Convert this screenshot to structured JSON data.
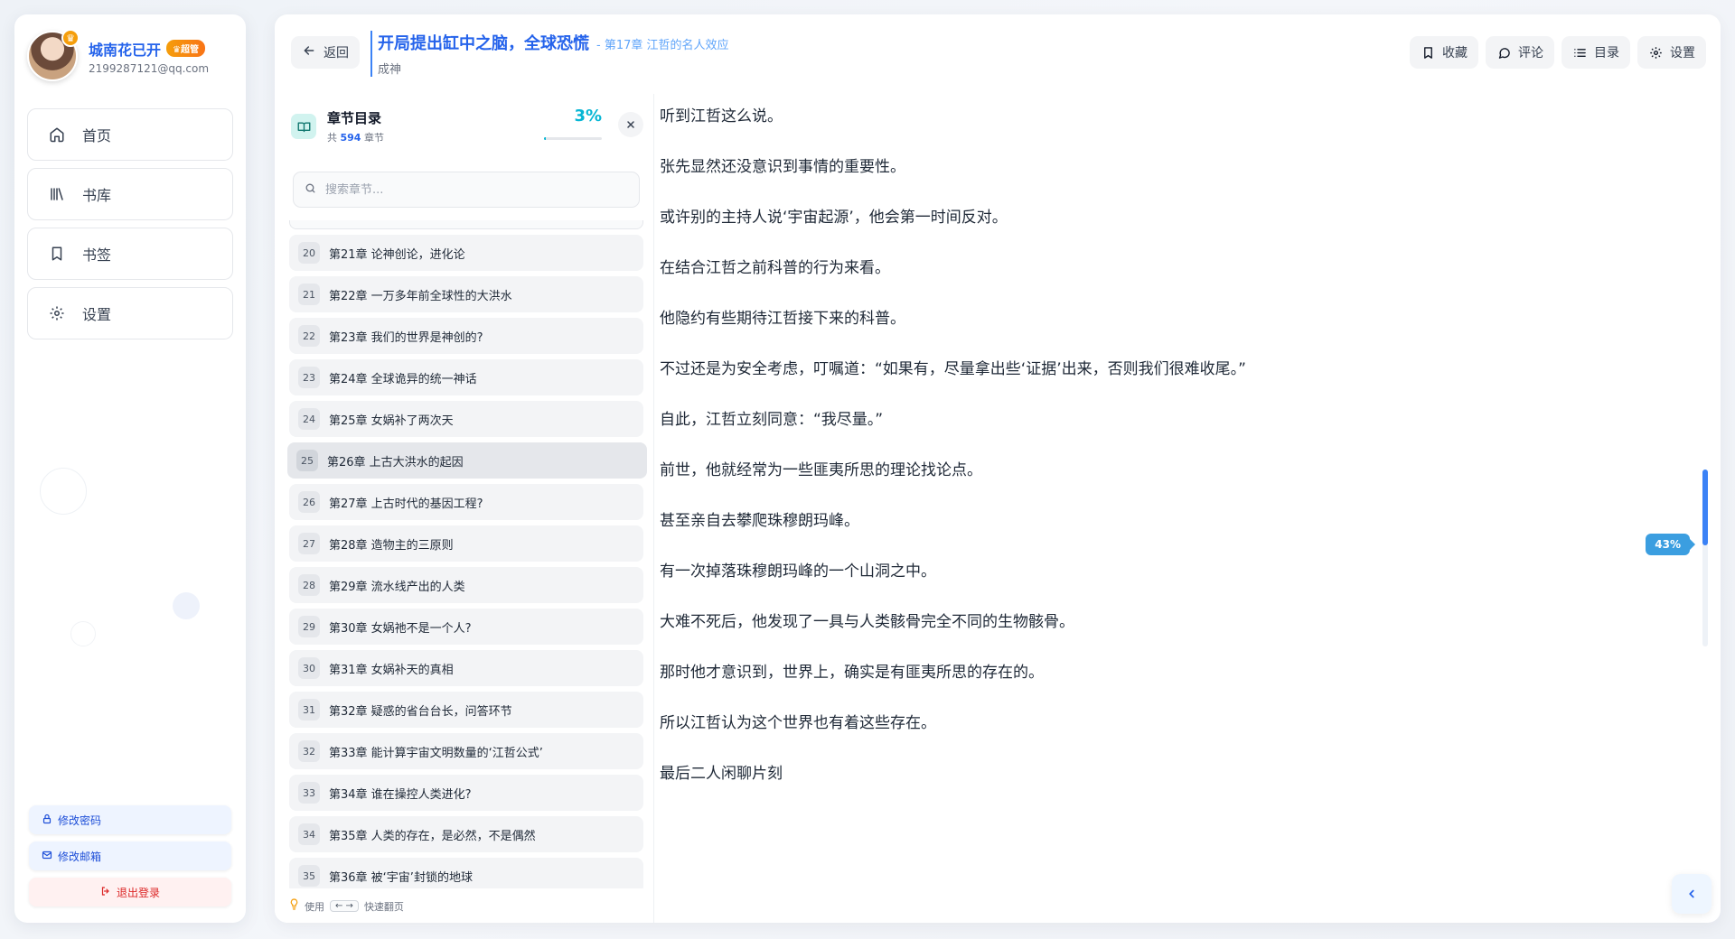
{
  "user": {
    "name": "城南花已开",
    "role_badge": "♛超管",
    "email": "2199287121@qq.com"
  },
  "nav": [
    {
      "label": "首页",
      "icon": "home-icon"
    },
    {
      "label": "书库",
      "icon": "library-icon"
    },
    {
      "label": "书签",
      "icon": "bookmark-icon"
    },
    {
      "label": "设置",
      "icon": "gear-icon"
    }
  ],
  "sidebar_actions": {
    "change_password": "修改密码",
    "change_email": "修改邮箱",
    "logout": "退出登录"
  },
  "header": {
    "back_label": "返回",
    "book_title": "开局提出缸中之脑，全球恐慌",
    "chapter_subtitle": "- 第17章 江哲的名人效应",
    "category": "成神",
    "actions": [
      {
        "label": "收藏",
        "icon": "bookmark-icon"
      },
      {
        "label": "评论",
        "icon": "comment-icon"
      },
      {
        "label": "目录",
        "icon": "list-icon"
      },
      {
        "label": "设置",
        "icon": "gear-icon"
      }
    ]
  },
  "toc": {
    "title": "章节目录",
    "count_prefix": "共",
    "count_value": "594",
    "count_suffix": "章节",
    "progress_label": "3%",
    "progress_fraction": 0.03,
    "search_placeholder": "搜索章节...",
    "active_index": 25,
    "items": [
      {
        "num": "20",
        "title": "第21章 论神创论，进化论"
      },
      {
        "num": "21",
        "title": "第22章 一万多年前全球性的大洪水"
      },
      {
        "num": "22",
        "title": "第23章 我们的世界是神创的?"
      },
      {
        "num": "23",
        "title": "第24章 全球诡异的统一神话"
      },
      {
        "num": "24",
        "title": "第25章 女娲补了两次天"
      },
      {
        "num": "25",
        "title": "第26章 上古大洪水的起因"
      },
      {
        "num": "26",
        "title": "第27章 上古时代的基因工程?"
      },
      {
        "num": "27",
        "title": "第28章 造物主的三原则"
      },
      {
        "num": "28",
        "title": "第29章 流水线产出的人类"
      },
      {
        "num": "29",
        "title": "第30章 女娲祂不是一个人?"
      },
      {
        "num": "30",
        "title": "第31章 女娲补天的真相"
      },
      {
        "num": "31",
        "title": "第32章 疑惑的省台台长，问答环节"
      },
      {
        "num": "32",
        "title": "第33章 能计算宇宙文明数量的‘江哲公式’"
      },
      {
        "num": "33",
        "title": "第34章 谁在操控人类进化?"
      },
      {
        "num": "34",
        "title": "第35章 人类的存在，是必然，不是偶然"
      },
      {
        "num": "35",
        "title": "第36章 被‘宇宙’封锁的地球"
      }
    ],
    "footer_prefix": "使用",
    "footer_keys": "← →",
    "footer_suffix": "快速翻页"
  },
  "content": {
    "paragraphs": [
      "听到江哲这么说。",
      "张先显然还没意识到事情的重要性。",
      "或许别的主持人说‘宇宙起源’，他会第一时间反对。",
      "在结合江哲之前科普的行为来看。",
      "他隐约有些期待江哲接下来的科普。",
      "不过还是为安全考虑，叮嘱道：“如果有，尽量拿出些‘证据’出来，否则我们很难收尾。”",
      "自此，江哲立刻同意：“我尽量。”",
      "前世，他就经常为一些匪夷所思的理论找论点。",
      "甚至亲自去攀爬珠穆朗玛峰。",
      "有一次掉落珠穆朗玛峰的一个山洞之中。",
      "大难不死后，他发现了一具与人类骸骨完全不同的生物骸骨。",
      "那时他才意识到，世界上，确实是有匪夷所思的存在的。",
      "所以江哲认为这个世界也有着这些存在。",
      "最后二人闲聊片刻"
    ],
    "scroll_progress_label": "43%"
  }
}
